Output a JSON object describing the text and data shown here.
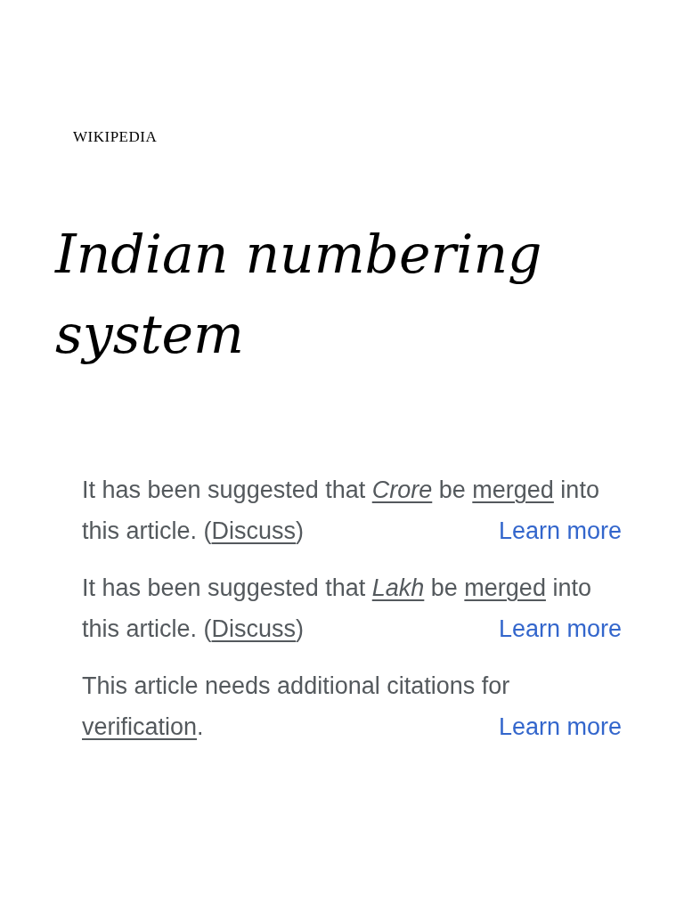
{
  "logo": {
    "text": "WIKIPEDIA"
  },
  "title": "Indian numbering system",
  "notices": [
    {
      "parts": [
        {
          "kind": "text",
          "text": "It has been suggested that "
        },
        {
          "kind": "link",
          "text": "Crore",
          "italic": true
        },
        {
          "kind": "text",
          "text": " be "
        },
        {
          "kind": "link",
          "text": "merged",
          "italic": false
        },
        {
          "kind": "text",
          "text": " into this article. ("
        },
        {
          "kind": "link",
          "text": "Discuss",
          "italic": false
        },
        {
          "kind": "text",
          "text": ")"
        }
      ],
      "learn_more": "Learn more"
    },
    {
      "parts": [
        {
          "kind": "text",
          "text": "It has been suggested that "
        },
        {
          "kind": "link",
          "text": "Lakh",
          "italic": true
        },
        {
          "kind": "text",
          "text": " be "
        },
        {
          "kind": "link",
          "text": "merged",
          "italic": false
        },
        {
          "kind": "text",
          "text": " into this article. ("
        },
        {
          "kind": "link",
          "text": "Discuss",
          "italic": false
        },
        {
          "kind": "text",
          "text": ")"
        }
      ],
      "learn_more": "Learn more"
    },
    {
      "parts": [
        {
          "kind": "text",
          "text": "This article needs additional citations for "
        },
        {
          "kind": "link",
          "text": "verification",
          "italic": false
        },
        {
          "kind": "text",
          "text": "."
        }
      ],
      "learn_more": "Learn more"
    }
  ]
}
